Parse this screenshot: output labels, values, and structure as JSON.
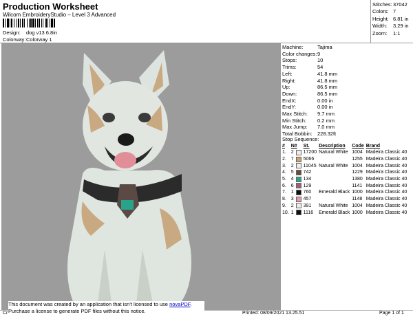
{
  "header": {
    "title": "Production Worksheet",
    "subtitle": "Wilcom EmbroideryStudio – Level 3 Advanced",
    "design_label": "Design:",
    "design_value": "dog v13 6.8in",
    "colorway_label": "Colorway:",
    "colorway_value": "Colorway 1"
  },
  "summary": [
    {
      "label": "Stitches:",
      "value": "37042"
    },
    {
      "label": "Colors:",
      "value": "7"
    },
    {
      "label": "Height:",
      "value": "6.81 in"
    },
    {
      "label": "Width:",
      "value": "3.29 in"
    },
    {
      "label": "Zoom:",
      "value": "1:1"
    }
  ],
  "details": [
    {
      "label": "Machine:",
      "value": "Tajima"
    },
    {
      "label": "Color changes:",
      "value": "9"
    },
    {
      "label": "Stops:",
      "value": "10"
    },
    {
      "label": "Trims:",
      "value": "54"
    },
    {
      "label": "Left:",
      "value": "41.8 mm"
    },
    {
      "label": "Right:",
      "value": "41.8 mm"
    },
    {
      "label": "Up:",
      "value": "86.5 mm"
    },
    {
      "label": "Down:",
      "value": "86.5 mm"
    },
    {
      "label": "EndX:",
      "value": "0.00 in"
    },
    {
      "label": "EndY:",
      "value": "0.00 in"
    },
    {
      "label": "Max Stitch:",
      "value": "9.7 mm"
    },
    {
      "label": "Min Stitch:",
      "value": "0.2 mm"
    },
    {
      "label": "Max Jump:",
      "value": "7.0 mm"
    },
    {
      "label": "Total Bobbin:",
      "value": "228.32ft"
    }
  ],
  "stop_sequence": {
    "label": "Stop Sequence:",
    "headers": [
      "#",
      "N#",
      "St.",
      "Description",
      "Code",
      "Brand"
    ],
    "rows": [
      {
        "n": "1.",
        "needle": "2",
        "color": "#ececec",
        "st": "17200",
        "desc": "Natural White",
        "code": "1004",
        "brand": "Madeira Classic 40"
      },
      {
        "n": "2.",
        "needle": "7",
        "color": "#c8a26e",
        "st": "5066",
        "desc": "",
        "code": "1255",
        "brand": "Madeira Classic 40"
      },
      {
        "n": "3.",
        "needle": "2",
        "color": "#ececec",
        "st": "11045",
        "desc": "Natural White",
        "code": "1004",
        "brand": "Madeira Classic 40"
      },
      {
        "n": "4.",
        "needle": "5",
        "color": "#6b4a3a",
        "st": "742",
        "desc": "",
        "code": "1229",
        "brand": "Madeira Classic 40"
      },
      {
        "n": "5.",
        "needle": "4",
        "color": "#2aa38d",
        "st": "134",
        "desc": "",
        "code": "1380",
        "brand": "Madeira Classic 40"
      },
      {
        "n": "6.",
        "needle": "6",
        "color": "#a06070",
        "st": "129",
        "desc": "",
        "code": "1141",
        "brand": "Madeira Classic 40"
      },
      {
        "n": "7.",
        "needle": "1",
        "color": "#111111",
        "st": "760",
        "desc": "Emerald Black",
        "code": "1000",
        "brand": "Madeira Classic 40"
      },
      {
        "n": "8.",
        "needle": "3",
        "color": "#e89aaa",
        "st": "457",
        "desc": "",
        "code": "1148",
        "brand": "Madeira Classic 40"
      },
      {
        "n": "9.",
        "needle": "2",
        "color": "#ececec",
        "st": "391",
        "desc": "Natural White",
        "code": "1004",
        "brand": "Madeira Classic 40"
      },
      {
        "n": "10.",
        "needle": "1",
        "color": "#111111",
        "st": "1116",
        "desc": "Emerald Black",
        "code": "1000",
        "brand": "Madeira Classic 40"
      }
    ]
  },
  "notice": {
    "line1_pre": "This document was created by an application that isn't licensed to use ",
    "line1_link": "novaPDF",
    "line1_post": ".",
    "line2": "Purchase a license to generate PDF files without this notice."
  },
  "footer": {
    "left": "Cr",
    "printed": "Printed: 08/09/2021 13.25.51",
    "page": "Page 1 of 1"
  }
}
